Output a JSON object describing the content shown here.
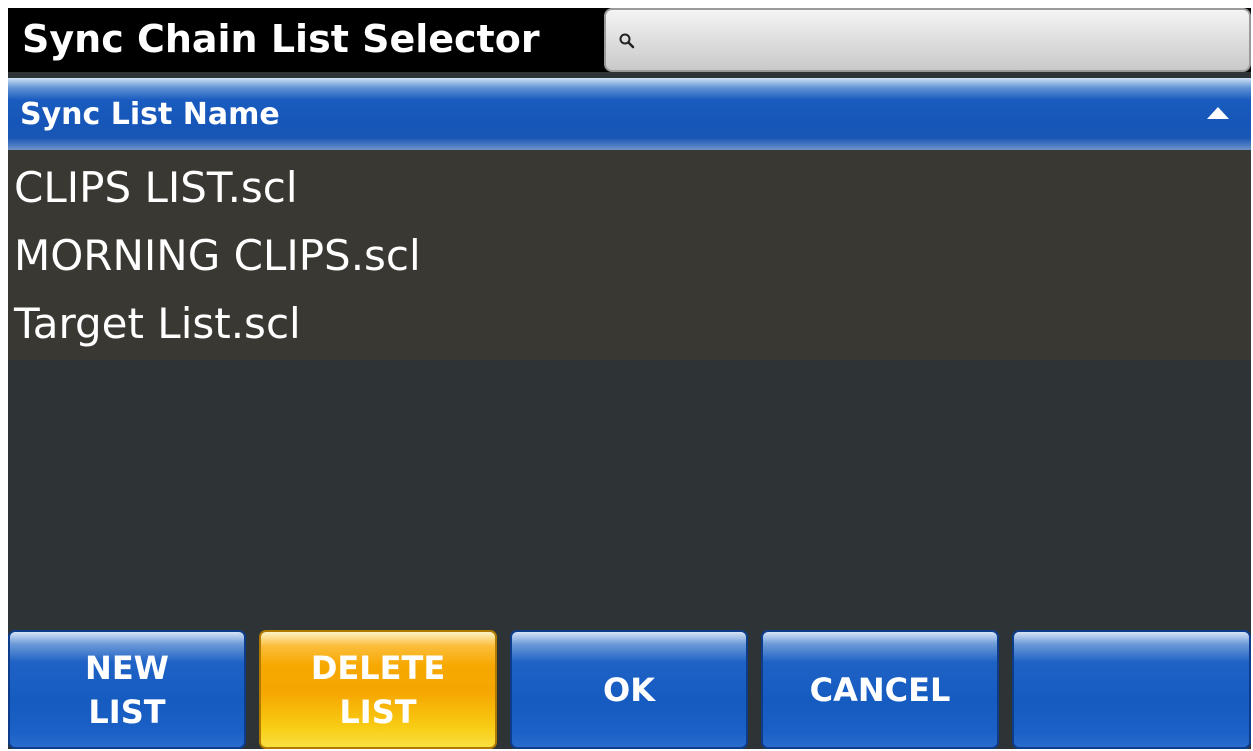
{
  "window": {
    "title": "Sync Chain List Selector"
  },
  "search": {
    "value": "",
    "placeholder": "",
    "icon": "search-icon"
  },
  "table": {
    "column_header": "Sync List Name",
    "sort_direction": "ascending",
    "items": [
      "CLIPS LIST.scl",
      "MORNING CLIPS.scl",
      "Target List.scl"
    ]
  },
  "buttons": {
    "new_list": "NEW\nLIST",
    "delete_list": "DELETE\nLIST",
    "ok": "OK",
    "cancel": "CANCEL",
    "blank": ""
  },
  "colors": {
    "accent_blue": "#1656b8",
    "delete_orange": "#f7a800",
    "list_background": "#393832",
    "panel_background": "#2e3436"
  }
}
